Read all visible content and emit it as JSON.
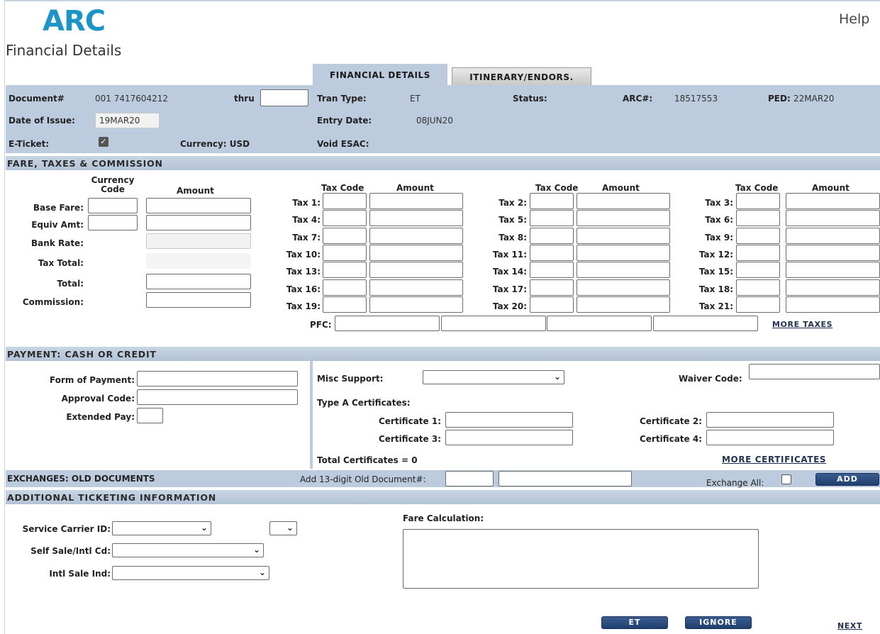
{
  "header": {
    "logo": "ARC",
    "page_title": "Financial Details",
    "help_label": "Help"
  },
  "colors": {
    "band": "#bccbdd",
    "logo": "#1c95c6",
    "button": "#2b4d7e"
  },
  "tabs": [
    {
      "label": "FINANCIAL DETAILS",
      "active": true
    },
    {
      "label": "ITINERARY/ENDORS.",
      "active": false
    }
  ],
  "document": {
    "document_label": "Document#",
    "document_value": "001 7417604212",
    "thru_label": "thru",
    "tran_type_label": "Tran Type:",
    "tran_type_value": "ET",
    "status_label": "Status:",
    "arc_label": "ARC#:",
    "arc_value": "18517553",
    "ped_label": "PED:",
    "ped_value": "22MAR20",
    "date_issue_label": "Date of Issue:",
    "date_issue_value": "19MAR20",
    "entry_date_label": "Entry Date:",
    "entry_date_value": "08JUN20",
    "eticket_label": "E-Ticket:",
    "eticket_checked": true,
    "currency_label": "Currency: USD",
    "void_label": "Void ESAC:"
  },
  "fare": {
    "section_title": "FARE, TAXES & COMMISSION",
    "col_currency": "Currency Code",
    "col_amount": "Amount",
    "col_tax_code": "Tax Code",
    "rows": [
      "Base Fare:",
      "Equiv Amt:",
      "Bank Rate:",
      "Tax Total:",
      "Total:",
      "Commission:"
    ],
    "taxes": [
      "Tax 1:",
      "Tax 2:",
      "Tax 3:",
      "Tax 4:",
      "Tax 5:",
      "Tax 6:",
      "Tax 7:",
      "Tax 8:",
      "Tax 9:",
      "Tax 10:",
      "Tax 11:",
      "Tax 12:",
      "Tax 13:",
      "Tax 14:",
      "Tax 15:",
      "Tax 16:",
      "Tax 17:",
      "Tax 18:",
      "Tax 19:",
      "Tax 20:",
      "Tax 21:"
    ],
    "pfc_label": "PFC:",
    "more_taxes": "MORE TAXES"
  },
  "payment": {
    "section_title": "PAYMENT: CASH OR CREDIT",
    "form_of_payment": "Form of Payment:",
    "approval_code": "Approval Code:",
    "extended_pay": "Extended Pay:",
    "misc_support": "Misc Support:",
    "waiver_code": "Waiver Code:",
    "type_a": "Type A Certificates:",
    "cert1": "Certificate 1:",
    "cert2": "Certificate 2:",
    "cert3": "Certificate 3:",
    "cert4": "Certificate 4:",
    "total_certs": "Total Certificates = 0",
    "more_certs": "MORE CERTIFICATES"
  },
  "exchanges": {
    "title": "EXCHANGES: OLD DOCUMENTS",
    "add_label": "Add 13-digit Old Document#:",
    "exchange_all": "Exchange All:",
    "add_button": "ADD"
  },
  "additional": {
    "section_title": "ADDITIONAL TICKETING INFORMATION",
    "service_carrier": "Service Carrier ID:",
    "self_sale": "Self Sale/Intl Cd:",
    "intl_sale": "Intl Sale Ind:",
    "fare_calc": "Fare Calculation:"
  },
  "footer": {
    "et_button": "ET",
    "ignore_button": "IGNORE",
    "next_link": "NEXT"
  }
}
